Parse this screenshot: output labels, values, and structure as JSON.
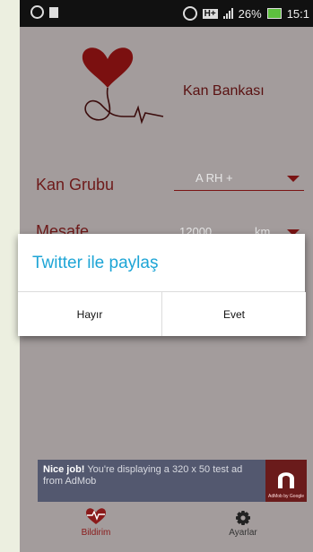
{
  "status_bar": {
    "signal_label": "H+",
    "battery_percent": "26%",
    "time": "15:1"
  },
  "app": {
    "logo_text": "Kan Bankası",
    "blood_group": {
      "label": "Kan Grubu",
      "value": "A RH +"
    },
    "distance": {
      "label": "Mesafe",
      "value": "12000",
      "unit": "km"
    }
  },
  "dialog": {
    "title": "Twitter ile paylaş",
    "no_button": "Hayır",
    "yes_button": "Evet"
  },
  "ad": {
    "headline": "Nice job!",
    "body": "You're displaying a 320 x 50 test ad from AdMob",
    "icon_label": "AdMob by Google"
  },
  "bottom_nav": {
    "items": [
      {
        "label": "Bildirim",
        "icon": "heartbeat-icon"
      },
      {
        "label": "Ayarlar",
        "icon": "gear-icon"
      }
    ]
  },
  "colors": {
    "accent": "#1ea5d6",
    "brand": "#7a1313"
  }
}
